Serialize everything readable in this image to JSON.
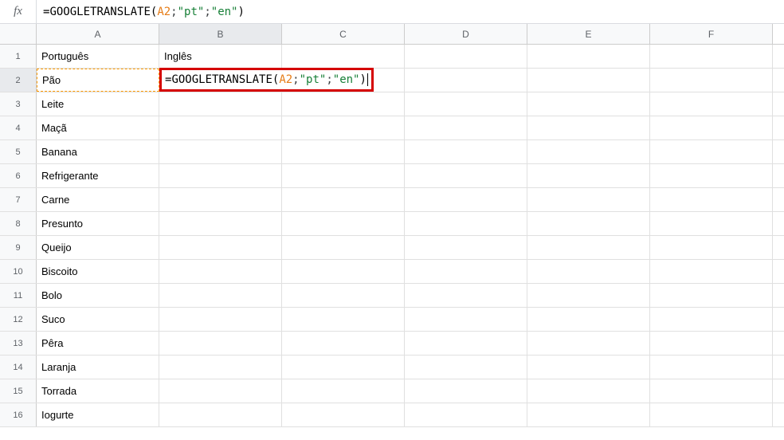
{
  "formula_bar": {
    "prefix_eq": "=",
    "fn": "GOOGLETRANSLATE",
    "open": "(",
    "ref": "A2",
    "sep1": "; ",
    "arg2": "\"pt\"",
    "sep2": "; ",
    "arg3": "\"en\"",
    "close": ")"
  },
  "columns": [
    "A",
    "B",
    "C",
    "D",
    "E",
    "F"
  ],
  "header_row": {
    "col_a": "Português",
    "col_b": "Inglês"
  },
  "column_a_values": {
    "2": "Pão",
    "3": "Leite",
    "4": "Maçã",
    "5": "Banana",
    "6": "Refrigerante",
    "7": "Carne",
    "8": "Presunto",
    "9": "Queijo",
    "10": "Biscoito",
    "11": "Bolo",
    "12": "Suco",
    "13": "Pêra",
    "14": "Laranja",
    "15": "Torrada",
    "16": "Iogurte"
  },
  "editing_cell": {
    "prefix_eq": "=",
    "fn": "GOOGLETRANSLATE",
    "open": "(",
    "ref": "A2",
    "sep1": "; ",
    "arg2": "\"pt\"",
    "sep2": "; ",
    "arg3": "\"en\"",
    "close": ")"
  },
  "active": {
    "row": 2,
    "col": "B"
  }
}
